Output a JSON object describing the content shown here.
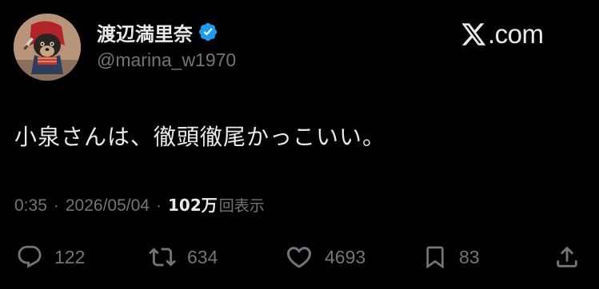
{
  "author": {
    "display_name": "渡辺満里奈",
    "handle": "@marina_w1970",
    "verified": true,
    "avatar_icon": "dog-in-costume-avatar"
  },
  "brand": {
    "text": ".com",
    "icon": "x-logo-icon"
  },
  "tweet": {
    "text": "小泉さんは、徹頭徹尾かっこいい。"
  },
  "meta": {
    "time": "0:35",
    "separator": "·",
    "date": "2026/05/04",
    "views_count": "102万",
    "views_label": "回表示"
  },
  "actions": {
    "reply_count": "122",
    "retweet_count": "634",
    "like_count": "4693",
    "bookmark_count": "83"
  },
  "colors": {
    "background": "#000000",
    "primary_text": "#e7e9ea",
    "secondary_text": "#71767b",
    "verified_blue": "#1d9bf0"
  }
}
